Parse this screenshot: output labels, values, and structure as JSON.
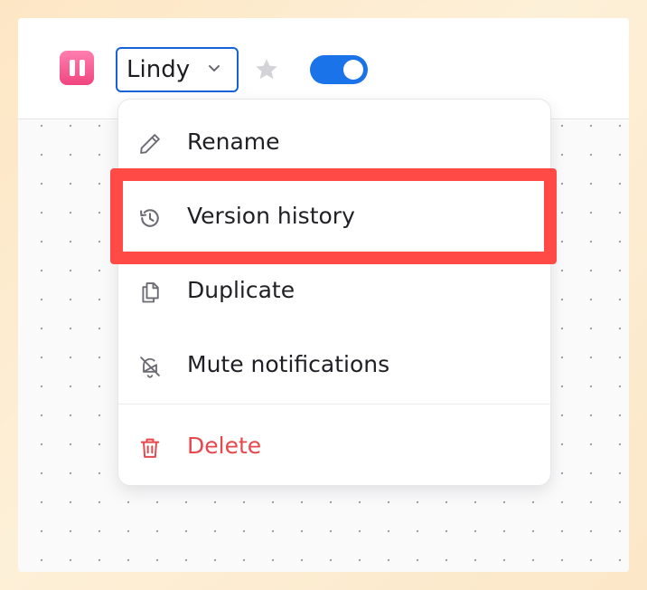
{
  "toolbar": {
    "app_icon": "pause-icon",
    "agent_name": "Lindy",
    "star_icon": "star-icon",
    "toggle_on": true,
    "toggle_color": "#1a73e8"
  },
  "menu": {
    "items": [
      {
        "label": "Rename",
        "icon": "pencil-icon"
      },
      {
        "label": "Version history",
        "icon": "history-icon"
      },
      {
        "label": "Duplicate",
        "icon": "copy-icon"
      },
      {
        "label": "Mute notifications",
        "icon": "bell-off-icon"
      },
      {
        "label": "Delete",
        "icon": "trash-icon",
        "color": "#e5484d"
      }
    ]
  },
  "highlight_color": "#ff4a45"
}
